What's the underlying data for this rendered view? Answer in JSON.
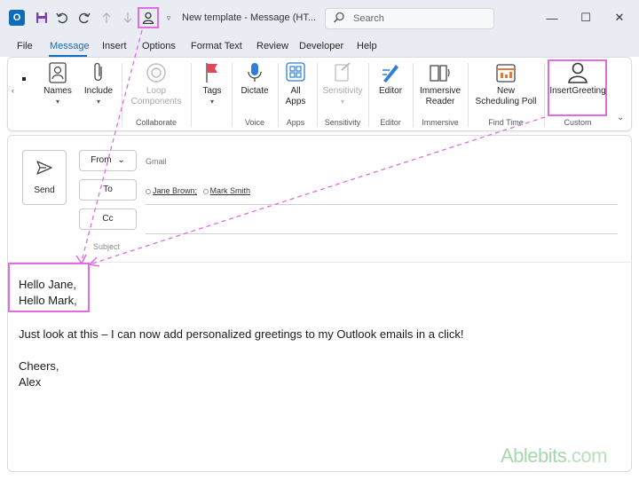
{
  "window": {
    "title": "New template  -  Message (HT...",
    "search_placeholder": "Search",
    "minimize": "—",
    "maximize": "☐",
    "close": "✕"
  },
  "menu": {
    "items": [
      {
        "label": "File"
      },
      {
        "label": "Message",
        "active": true
      },
      {
        "label": "Insert"
      },
      {
        "label": "Options"
      },
      {
        "label": "Format Text"
      },
      {
        "label": "Review"
      },
      {
        "label": "Developer"
      },
      {
        "label": "Help"
      }
    ]
  },
  "ribbon": {
    "buttons": {
      "names": "Names",
      "include": "Include",
      "loop_line1": "Loop",
      "loop_line2": "Components",
      "tags": "Tags",
      "dictate": "Dictate",
      "all_apps_line1": "All",
      "all_apps_line2": "Apps",
      "sensitivity": "Sensitivity",
      "editor": "Editor",
      "immersive_line1": "Immersive",
      "immersive_line2": "Reader",
      "poll_line1": "New",
      "poll_line2": "Scheduling Poll",
      "insert_greeting": "InsertGreeting"
    },
    "groups": {
      "collaborate": "Collaborate",
      "voice": "Voice",
      "apps": "Apps",
      "sensitivity": "Sensitivity",
      "editor": "Editor",
      "immersive": "Immersive",
      "find_time": "Find Time",
      "custom": "Custom"
    }
  },
  "compose": {
    "send": "Send",
    "from_label": "From",
    "from_value": "Gmail",
    "to_label": "To",
    "cc_label": "Cc",
    "recipients": [
      "Jane Brown;",
      "Mark Smith"
    ],
    "subject_label": "Subject"
  },
  "body": {
    "greeting_line1": "Hello Jane,",
    "greeting_line2": "Hello Mark,",
    "message": "Just look at this – I can now add personalized greetings to my Outlook emails in a click!",
    "closing": "Cheers,",
    "signature": "Alex"
  },
  "watermark": {
    "brand": "Ablebits",
    "suffix": ".com"
  },
  "colors": {
    "accent": "#0f6cbd",
    "highlight": "#e06ce0",
    "title_bg": "#e9edf3"
  }
}
